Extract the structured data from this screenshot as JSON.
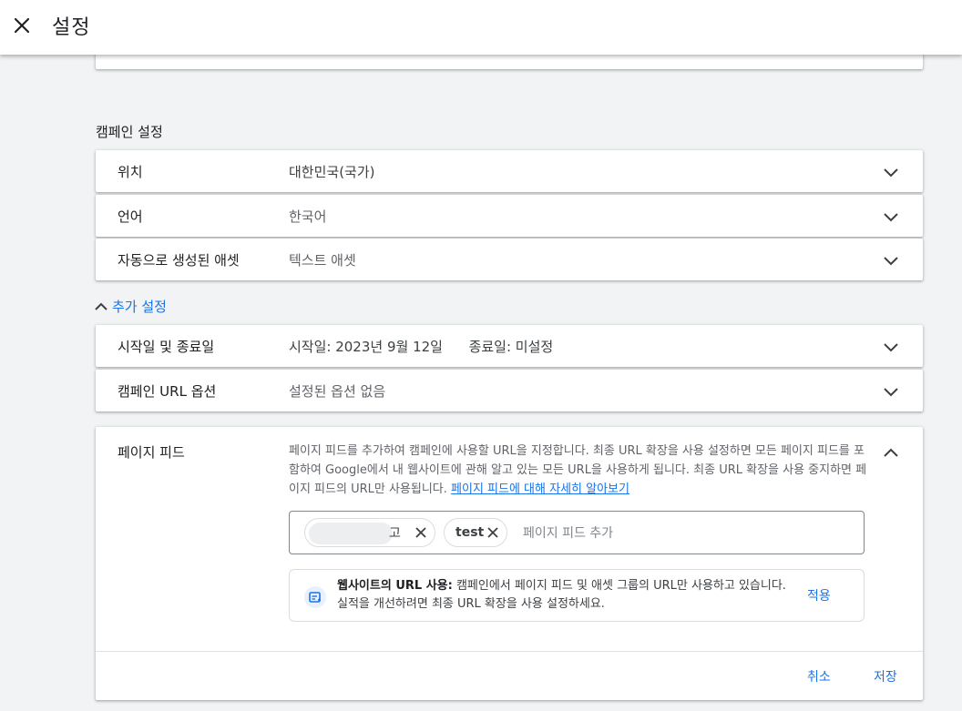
{
  "header": {
    "title": "설정"
  },
  "campaign_settings": {
    "title": "캠페인 설정",
    "rows": [
      {
        "label": "위치",
        "value": "대한민국(국가)"
      },
      {
        "label": "언어",
        "value": "한국어"
      },
      {
        "label": "자동으로 생성된 애셋",
        "value": "텍스트 애셋"
      }
    ]
  },
  "more_settings": {
    "label": "추가 설정",
    "rows": [
      {
        "label": "시작일 및 종료일",
        "value": "시작일: 2023년 9월 12일      종료일: 미설정"
      },
      {
        "label": "캠페인 URL 옵션",
        "value": "설정된 옵션 없음"
      }
    ]
  },
  "page_feed": {
    "label": "페이지 피드",
    "description": "페이지 피드를 추가하여 캠페인에 사용할 URL을 지정합니다. 최종 URL 확장을 사용 설정하면 모든 페이지 피드를 포함하여 Google에서 내 웹사이트에 관해 알고 있는 모든 URL을 사용하게 됩니다. 최종 URL 확장을 사용 중지하면 페이지 피드의 URL만 사용됩니다.",
    "learn_more_link": "페이지 피드에 대해 자세히 알아보기",
    "chips": [
      {
        "label": "고"
      },
      {
        "label": "test"
      }
    ],
    "input_placeholder": "페이지 피드 추가",
    "notice": {
      "bold": "웹사이트의 URL 사용:",
      "text": " 캠페인에서 페이지 피드 및 애셋 그룹의 URL만 사용하고 있습니다. 실적을 개선하려면 최종 URL 확장을 사용 설정하세요.",
      "apply_label": "적용"
    },
    "cancel_label": "취소",
    "save_label": "저장"
  },
  "colors": {
    "accent": "#1a73e8",
    "background": "#f1f3f4",
    "card": "#ffffff"
  }
}
